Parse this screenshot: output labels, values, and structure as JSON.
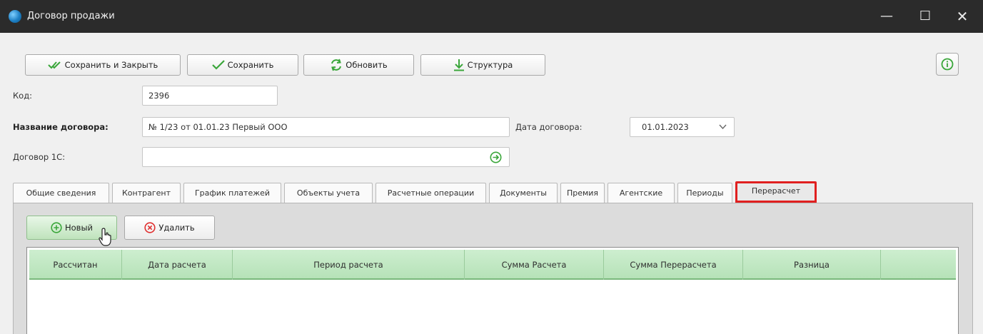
{
  "window": {
    "title": "Договор продажи",
    "controls": {
      "minimize": "—",
      "maximize": "☐",
      "close": "✕"
    }
  },
  "toolbar": {
    "save_close_label": "Сохранить и Закрыть",
    "save_label": "Сохранить",
    "refresh_label": "Обновить",
    "structure_label": "Структура"
  },
  "form": {
    "code_label": "Код:",
    "code_value": "2396",
    "name_label": "Название договора:",
    "name_value": "№ 1/23 от 01.01.23 Первый ООО",
    "date_label": "Дата договора:",
    "date_value": "01.01.2023",
    "contract_1c_label": "Договор 1С:",
    "contract_1c_value": ""
  },
  "tabs": [
    {
      "label": "Общие сведения"
    },
    {
      "label": "Контрагент"
    },
    {
      "label": "График платежей"
    },
    {
      "label": "Объекты учета"
    },
    {
      "label": "Расчетные операции"
    },
    {
      "label": "Документы"
    },
    {
      "label": "Премия"
    },
    {
      "label": "Агентские"
    },
    {
      "label": "Периоды"
    },
    {
      "label": "Перерасчет",
      "active": true
    }
  ],
  "panel": {
    "new_label": "Новый",
    "delete_label": "Удалить"
  },
  "table": {
    "columns": [
      "Рассчитан",
      "Дата расчета",
      "Период расчета",
      "Сумма Расчета",
      "Сумма Перерасчета",
      "Разница",
      ""
    ],
    "rows": []
  },
  "colors": {
    "titlebar": "#2b2b2b",
    "accent_green": "#3aa63a",
    "highlight_red": "#e02020",
    "grid_header": "#c3e8c5"
  }
}
